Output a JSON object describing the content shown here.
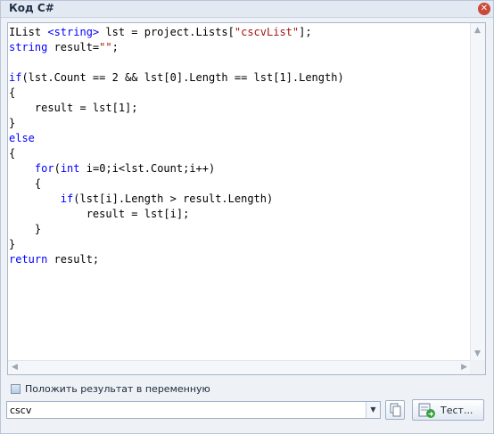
{
  "window": {
    "title": "Код C#",
    "close_icon": "close-icon"
  },
  "code_lines": [
    [
      {
        "t": "IList ",
        "c": ""
      },
      {
        "t": "<string>",
        "c": "kw"
      },
      {
        "t": " lst = project.Lists[",
        "c": ""
      },
      {
        "t": "\"cscvList\"",
        "c": "str"
      },
      {
        "t": "];",
        "c": ""
      }
    ],
    [
      {
        "t": "string",
        "c": "kw"
      },
      {
        "t": " result=",
        "c": ""
      },
      {
        "t": "\"\"",
        "c": "str"
      },
      {
        "t": ";",
        "c": ""
      }
    ],
    [],
    [
      {
        "t": "if",
        "c": "kw"
      },
      {
        "t": "(lst.Count == 2 && lst[0].Length == lst[1].Length)",
        "c": ""
      }
    ],
    [
      {
        "t": "{",
        "c": ""
      }
    ],
    [
      {
        "t": "    result = lst[1];",
        "c": ""
      }
    ],
    [
      {
        "t": "}",
        "c": ""
      }
    ],
    [
      {
        "t": "else",
        "c": "kw"
      }
    ],
    [
      {
        "t": "{",
        "c": ""
      }
    ],
    [
      {
        "t": "    ",
        "c": ""
      },
      {
        "t": "for",
        "c": "kw"
      },
      {
        "t": "(",
        "c": ""
      },
      {
        "t": "int",
        "c": "kw"
      },
      {
        "t": " i=0;i<lst.Count;i++)",
        "c": ""
      }
    ],
    [
      {
        "t": "    {",
        "c": ""
      }
    ],
    [
      {
        "t": "        ",
        "c": ""
      },
      {
        "t": "if",
        "c": "kw"
      },
      {
        "t": "(lst[i].Length > result.Length)",
        "c": ""
      }
    ],
    [
      {
        "t": "            result = lst[i];",
        "c": ""
      }
    ],
    [
      {
        "t": "    }",
        "c": ""
      }
    ],
    [
      {
        "t": "}",
        "c": ""
      }
    ],
    [
      {
        "t": "return",
        "c": "kw"
      },
      {
        "t": " result;",
        "c": ""
      }
    ]
  ],
  "save_to_variable": {
    "label": "Положить результат в переменную",
    "checked": false
  },
  "variable_combo": {
    "value": "cscv"
  },
  "test_button": {
    "label": "Тест..."
  }
}
